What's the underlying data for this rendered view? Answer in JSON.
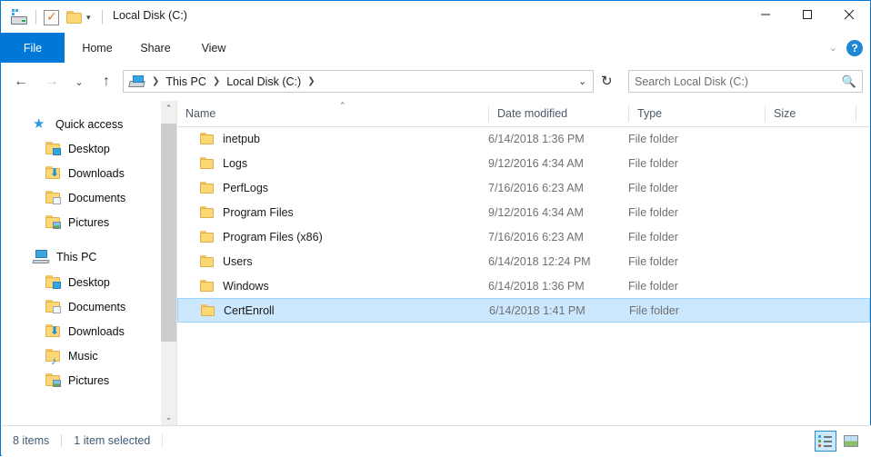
{
  "window": {
    "title": "Local Disk (C:)",
    "quick_access_toolbar": {
      "drive_icon": "computer-drive-icon",
      "properties_icon": "properties-checkbox-icon",
      "new_folder_icon": "new-folder-icon",
      "customize_caret": "▾"
    },
    "controls": {
      "minimize": "minimize-icon",
      "maximize": "maximize-icon",
      "close": "close-icon"
    }
  },
  "ribbon": {
    "tabs": [
      {
        "label": "File",
        "active": true
      },
      {
        "label": "Home",
        "active": false
      },
      {
        "label": "Share",
        "active": false
      },
      {
        "label": "View",
        "active": false
      }
    ],
    "expand_caret": "⌄",
    "help_label": "?"
  },
  "address": {
    "back": "←",
    "forward": "→",
    "history": "⌄",
    "up": "↑",
    "breadcrumbs": [
      "This PC",
      "Local Disk (C:)"
    ],
    "separator": "❯",
    "dropdown_caret": "⌄",
    "refresh": "↻"
  },
  "search": {
    "placeholder": "Search Local Disk (C:)",
    "value": "",
    "icon": "search-icon"
  },
  "sidebar": {
    "groups": [
      {
        "label": "Quick access",
        "icon": "star-pin-icon",
        "items": [
          {
            "label": "Desktop",
            "icon": "folder-desktop-icon",
            "pinned": true,
            "pin": "📌"
          },
          {
            "label": "Downloads",
            "icon": "folder-downloads-icon",
            "pinned": true,
            "pin": "📌"
          },
          {
            "label": "Documents",
            "icon": "folder-documents-icon",
            "pinned": true,
            "pin": "📌"
          },
          {
            "label": "Pictures",
            "icon": "folder-pictures-icon",
            "pinned": true,
            "pin": "📌"
          }
        ]
      },
      {
        "label": "This PC",
        "icon": "this-pc-icon",
        "items": [
          {
            "label": "Desktop",
            "icon": "folder-desktop-icon",
            "pinned": false,
            "pin": ""
          },
          {
            "label": "Documents",
            "icon": "folder-documents-icon",
            "pinned": false,
            "pin": ""
          },
          {
            "label": "Downloads",
            "icon": "folder-downloads-icon",
            "pinned": false,
            "pin": ""
          },
          {
            "label": "Music",
            "icon": "folder-music-icon",
            "pinned": false,
            "pin": ""
          },
          {
            "label": "Pictures",
            "icon": "folder-pictures-icon",
            "pinned": false,
            "pin": ""
          }
        ]
      }
    ],
    "scrollbar": {
      "up_arrow": "⌃",
      "down_arrow": "⌄"
    }
  },
  "filelist": {
    "columns": [
      {
        "key": "name",
        "label": "Name",
        "sorted": true,
        "sort_indicator": "⌃"
      },
      {
        "key": "date",
        "label": "Date modified",
        "sorted": false,
        "sort_indicator": ""
      },
      {
        "key": "type",
        "label": "Type",
        "sorted": false,
        "sort_indicator": ""
      },
      {
        "key": "size",
        "label": "Size",
        "sorted": false,
        "sort_indicator": ""
      }
    ],
    "rows": [
      {
        "name": "inetpub",
        "date": "6/14/2018 1:36 PM",
        "type": "File folder",
        "size": "",
        "icon": "folder-icon",
        "selected": false
      },
      {
        "name": "Logs",
        "date": "9/12/2016 4:34 AM",
        "type": "File folder",
        "size": "",
        "icon": "folder-icon",
        "selected": false
      },
      {
        "name": "PerfLogs",
        "date": "7/16/2016 6:23 AM",
        "type": "File folder",
        "size": "",
        "icon": "folder-icon",
        "selected": false
      },
      {
        "name": "Program Files",
        "date": "9/12/2016 4:34 AM",
        "type": "File folder",
        "size": "",
        "icon": "folder-icon",
        "selected": false
      },
      {
        "name": "Program Files (x86)",
        "date": "7/16/2016 6:23 AM",
        "type": "File folder",
        "size": "",
        "icon": "folder-icon",
        "selected": false
      },
      {
        "name": "Users",
        "date": "6/14/2018 12:24 PM",
        "type": "File folder",
        "size": "",
        "icon": "folder-icon",
        "selected": false
      },
      {
        "name": "Windows",
        "date": "6/14/2018 1:36 PM",
        "type": "File folder",
        "size": "",
        "icon": "folder-icon",
        "selected": false
      },
      {
        "name": "CertEnroll",
        "date": "6/14/2018 1:41 PM",
        "type": "File folder",
        "size": "",
        "icon": "folder-icon",
        "selected": true
      }
    ]
  },
  "statusbar": {
    "item_count": "8 items",
    "selection": "1 item selected",
    "views": [
      {
        "name": "details-view",
        "active": true
      },
      {
        "name": "large-icons-view",
        "active": false
      }
    ]
  },
  "colors": {
    "accent": "#0078d7",
    "selection_fill": "#cce8ff",
    "selection_border": "#99d1ff",
    "status_text": "#3c5a76",
    "folder_yellow": "#fcd775"
  }
}
